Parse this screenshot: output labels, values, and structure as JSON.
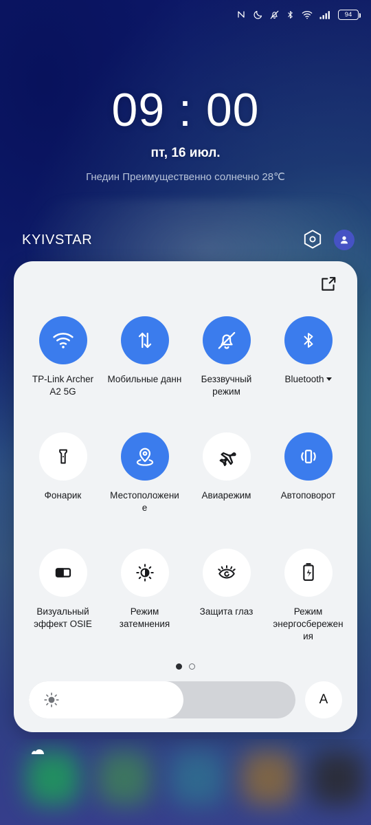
{
  "statusbar": {
    "icons": [
      "nfc-icon",
      "dnd-moon-icon",
      "notifications-muted-icon",
      "bluetooth-icon",
      "wifi-icon",
      "cellular-signal-icon"
    ],
    "battery_level": "94"
  },
  "lockscreen": {
    "time": "09 : 00",
    "date": "пт, 16 июл.",
    "weather": "Гнедин Преимущественно солнечно 28℃"
  },
  "carrier": {
    "name": "KYIVSTAR",
    "settings_icon": "hexagon-settings-icon",
    "avatar_icon": "user-avatar-icon"
  },
  "quick_settings": {
    "edit_label": "edit-icon",
    "tiles": [
      {
        "label": "TP-Link Archer A2 5G",
        "icon": "wifi-icon",
        "active": true,
        "caret": true
      },
      {
        "label": "Мобильные данные",
        "icon": "mobile-data-icon",
        "active": true,
        "caret": false,
        "clip": true
      },
      {
        "label": "Беззвучный режим",
        "icon": "bell-slash-icon",
        "active": true,
        "caret": false
      },
      {
        "label": "Bluetooth",
        "icon": "bluetooth-icon",
        "active": true,
        "caret": true
      },
      {
        "label": "Фонарик",
        "icon": "flashlight-icon",
        "active": false,
        "caret": false
      },
      {
        "label": "Местоположение",
        "icon": "location-pin-icon",
        "active": true,
        "caret": false
      },
      {
        "label": "Авиарежим",
        "icon": "airplane-icon",
        "active": false,
        "caret": false
      },
      {
        "label": "Автоповорот",
        "icon": "auto-rotate-icon",
        "active": true,
        "caret": false
      },
      {
        "label": "Визуальный эффект OSIE",
        "icon": "osie-visual-effect-icon",
        "active": false,
        "caret": false
      },
      {
        "label": "Режим затемнения",
        "icon": "dark-mode-icon",
        "active": false,
        "caret": false
      },
      {
        "label": "Защита глаз",
        "icon": "eye-comfort-icon",
        "active": false,
        "caret": false
      },
      {
        "label": "Режим энергосбережения",
        "icon": "battery-saver-icon",
        "active": false,
        "caret": false
      }
    ],
    "pages": {
      "count": 2,
      "current": 1
    },
    "brightness": {
      "icon": "brightness-sun-icon",
      "value_percent": "58",
      "auto_label": "A"
    }
  },
  "colors": {
    "tile_active": "#3b7ced",
    "tile_inactive": "#ffffff",
    "panel_background": "#f1f3f5",
    "avatar_background": "#4652c4",
    "text_primary": "#18191c"
  }
}
